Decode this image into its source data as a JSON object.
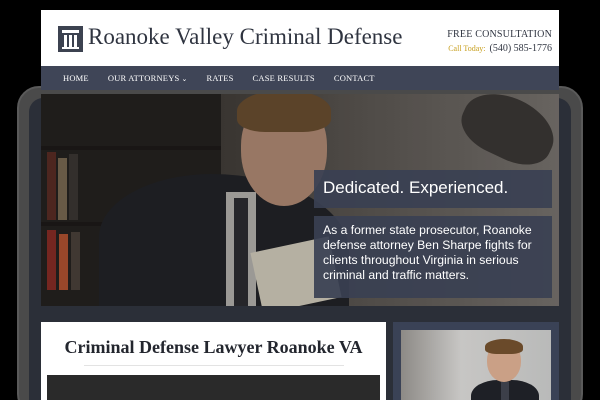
{
  "header": {
    "site_title": "Roanoke Valley Criminal Defense",
    "consultation_label": "FREE CONSULTATION",
    "call_today_label": "Call Today:",
    "phone": "(540) 585-1776"
  },
  "nav": {
    "items": [
      {
        "label": "HOME"
      },
      {
        "label": "OUR ATTORNEYS"
      },
      {
        "label": "RATES"
      },
      {
        "label": "CASE RESULTS"
      },
      {
        "label": "CONTACT"
      }
    ]
  },
  "hero": {
    "headline": "Dedicated. Experienced.",
    "body": "As a former state prosecutor, Roanoke defense attorney Ben Sharpe fights for clients throughout Virginia in serious criminal and traffic matters."
  },
  "main": {
    "title": "Criminal Defense Lawyer Roanoke VA"
  },
  "colors": {
    "nav_bg": "#3f4557",
    "accent_gold": "#c8a020",
    "overlay_box": "#3a4052",
    "text_dark": "#2f3440"
  },
  "icons": {
    "logo": "column-pillar-icon",
    "dropdown": "chevron-down-icon"
  }
}
